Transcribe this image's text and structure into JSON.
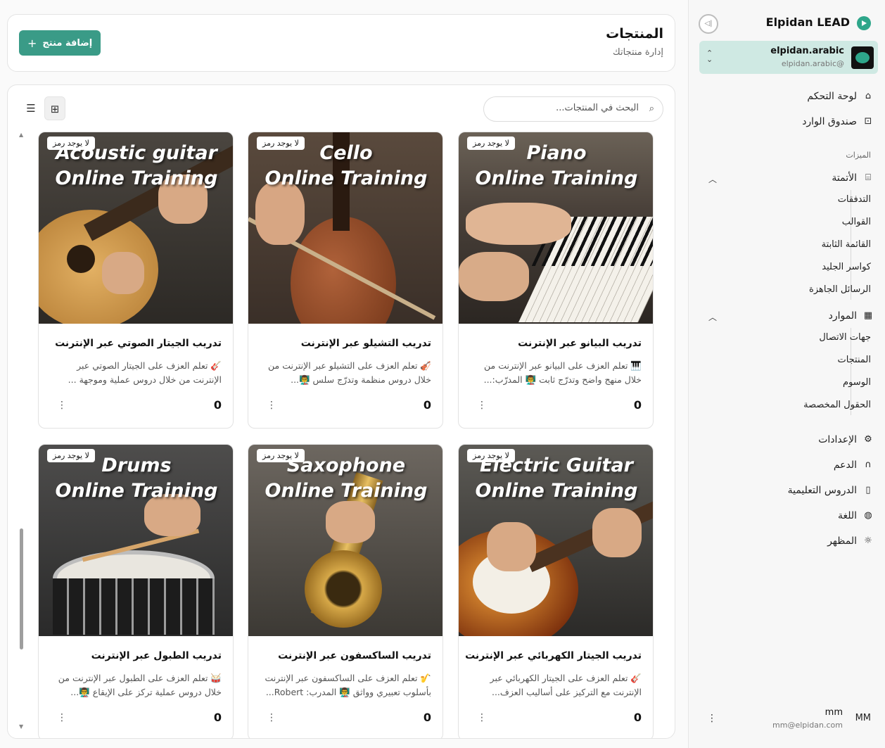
{
  "sidebar": {
    "app_name": "Elpidan LEAD",
    "account": {
      "name": "elpidan.arabic",
      "handle": "@elpidan.arabic"
    },
    "top_items": [
      {
        "label": "لوحة التحكم",
        "icon": "home-icon"
      },
      {
        "label": "صندوق الوارد",
        "icon": "inbox-icon"
      }
    ],
    "section_label": "الميزات",
    "automation": {
      "label": "الأتمتة",
      "icon": "robot-icon",
      "items": [
        "التدفقات",
        "القوالب",
        "القائمة الثابتة",
        "كواسر الجليد",
        "الرسائل الجاهزة"
      ]
    },
    "resources": {
      "label": "الموارد",
      "icon": "grid-icon",
      "items": [
        "جهات الاتصال",
        "المنتجات",
        "الوسوم",
        "الحقول المخصصة"
      ]
    },
    "bottom_items": [
      {
        "label": "الإعدادات",
        "icon": "gear-icon"
      },
      {
        "label": "الدعم",
        "icon": "headphones-icon"
      },
      {
        "label": "الدروس التعليمية",
        "icon": "book-icon"
      },
      {
        "label": "اللغة",
        "icon": "globe-icon"
      },
      {
        "label": "المظهر",
        "icon": "sun-icon"
      }
    ],
    "user": {
      "initials": "MM",
      "name": "mm",
      "email": "mm@elpidan.com"
    }
  },
  "header": {
    "title": "المنتجات",
    "subtitle": "إدارة منتجاتك",
    "add_button": "إضافة منتج"
  },
  "search": {
    "placeholder": "البحث في المنتجات..."
  },
  "products": [
    {
      "image_title_1": "Piano",
      "image_title_2": "Online Training",
      "badge": "لا يوجد رمز",
      "title": "تدريب البيانو عبر الإنترنت",
      "desc_1": "🎹 تعلم العزف على البيانو عبر الإنترنت من",
      "desc_2": "خلال منهج واضح وتدرّج ثابت 👨‍🏫 المدرّب:...",
      "price": "0"
    },
    {
      "image_title_1": "Cello",
      "image_title_2": "Online Training",
      "badge": "لا يوجد رمز",
      "title": "تدريب التشيلو عبر الإنترنت",
      "desc_1": "🎻 تعلم العزف على التشيلو عبر الإنترنت من",
      "desc_2": "خلال دروس منظمة وتدرّج سلس 👨‍🏫...",
      "price": "0"
    },
    {
      "image_title_1": "Acoustic guitar",
      "image_title_2": "Online Training",
      "badge": "لا يوجد رمز",
      "title": "تدريب الجيتار الصوتي عبر الإنترنت",
      "desc_1": "🎸 تعلم العزف على الجيتار الصوتي عبر",
      "desc_2": "الإنترنت من خلال دروس عملية وموجهة ...",
      "price": "0"
    },
    {
      "image_title_1": "Electric Guitar",
      "image_title_2": "Online Training",
      "badge": "لا يوجد رمز",
      "title": "تدريب الجيتار الكهربائي عبر الإنترنت",
      "desc_1": "🎸 تعلم العزف على الجيتار الكهربائي عبر",
      "desc_2": "الإنترنت مع التركيز على أساليب العزف...",
      "price": "0"
    },
    {
      "image_title_1": "Saxophone",
      "image_title_2": "Online Training",
      "badge": "لا يوجد رمز",
      "title": "تدريب الساكسفون عبر الإنترنت",
      "desc_1": "🎷 تعلم العزف على الساكسفون عبر الإنترنت",
      "desc_2": "بأسلوب تعبيري وواثق 👨‍🏫 المدرب: Robert...",
      "price": "0"
    },
    {
      "image_title_1": "Drums",
      "image_title_2": "Online Training",
      "badge": "لا يوجد رمز",
      "title": "تدريب الطبول عبر الإنترنت",
      "desc_1": "🥁 تعلم العزف على الطبول عبر الإنترنت من",
      "desc_2": "خلال دروس عملية تركز على الإيقاع 👨‍🏫...",
      "price": "0"
    }
  ],
  "colors": {
    "accent": "#3a9b87",
    "account_bg": "#cfe9e3"
  }
}
